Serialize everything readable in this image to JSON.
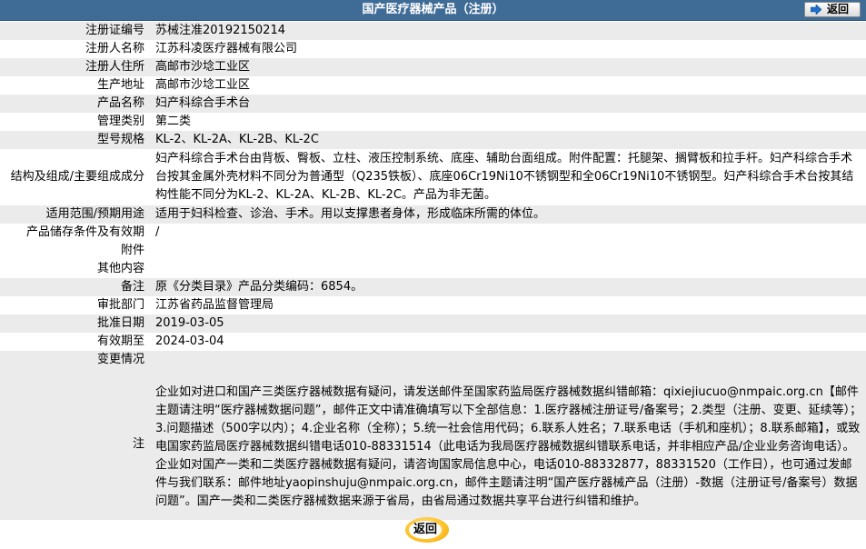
{
  "header": {
    "title": "国产医疗器械产品（注册）",
    "back_label": "返回"
  },
  "rows": [
    {
      "label": "注册证编号",
      "value": "苏械注准20192150214"
    },
    {
      "label": "注册人名称",
      "value": "江苏科凌医疗器械有限公司"
    },
    {
      "label": "注册人住所",
      "value": "高邮市沙埝工业区"
    },
    {
      "label": "生产地址",
      "value": "高邮市沙埝工业区"
    },
    {
      "label": "产品名称",
      "value": "妇产科综合手术台"
    },
    {
      "label": "管理类别",
      "value": "第二类"
    },
    {
      "label": "型号规格",
      "value": "KL-2、KL-2A、KL-2B、KL-2C"
    },
    {
      "label": "结构及组成/主要组成成分",
      "value": "妇产科综合手术台由背板、臀板、立柱、液压控制系统、底座、辅助台面组成。附件配置：托腿架、搁臂板和拉手杆。妇产科综合手术台按其金属外壳材料不同分为普通型（Q235铁板）、底座06Cr19Ni10不锈钢型和全06Cr19Ni10不锈钢型。妇产科综合手术台按其结构性能不同分为KL-2、KL-2A、KL-2B、KL-2C。产品为非无菌。"
    },
    {
      "label": "适用范围/预期用途",
      "value": "适用于妇科检查、诊治、手术。用以支撑患者身体，形成临床所需的体位。"
    },
    {
      "label": "产品储存条件及有效期",
      "value": "/"
    },
    {
      "label": "附件",
      "value": ""
    },
    {
      "label": "其他内容",
      "value": ""
    },
    {
      "label": "备注",
      "value": "原《分类目录》产品分类编码：6854。"
    },
    {
      "label": "审批部门",
      "value": "江苏省药品监督管理局"
    },
    {
      "label": "批准日期",
      "value": "2019-03-05"
    },
    {
      "label": "有效期至",
      "value": "2024-03-04"
    },
    {
      "label": "变更情况",
      "value": ""
    }
  ],
  "notice": {
    "label": "注",
    "text": "企业如对进口和国产三类医疗器械数据有疑问，请发送邮件至国家药监局医疗器械数据纠错邮箱：qixiejiucuo@nmpaic.org.cn【邮件主题请注明“医疗器械数据问题”，邮件正文中请准确填写以下全部信息：1.医疗器械注册证号/备案号；2.类型（注册、变更、延续等）；3.问题描述（500字以内）；4.企业名称（全称）；5.统一社会信用代码；6.联系人姓名；7.联系电话（手机和座机）；8.联系邮箱】，或致电国家药监局医疗器械数据纠错电话010-88331514（此电话为我局医疗器械数据纠错联系电话，并非相应产品/企业业务咨询电话）。企业如对国产一类和二类医疗器械数据有疑问，请咨询国家局信息中心，电话010-88332877，88331520（工作日），也可通过发邮件与我们联系：邮件地址yaopinshuju@nmpaic.org.cn，邮件主题请注明“国产医疗器械产品（注册）-数据（注册证号/备案号）数据问题”。国产一类和二类医疗器械数据来源于省局，由省局通过数据共享平台进行纠错和维护。"
  },
  "footer": {
    "back_label": "返回"
  }
}
